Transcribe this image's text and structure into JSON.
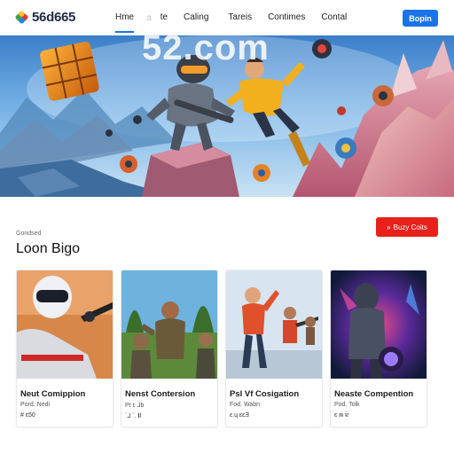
{
  "header": {
    "logo_text": "56d665",
    "nav": [
      {
        "label": "Hme",
        "active": true
      },
      {
        "label": "a"
      },
      {
        "label": "te"
      },
      {
        "label": "Caling"
      },
      {
        "label": "Tareis"
      },
      {
        "label": "Contimes"
      },
      {
        "label": "Contal"
      }
    ],
    "signin_label": "Bopin"
  },
  "hero": {
    "watermark": "52.com"
  },
  "section": {
    "label": "Gondsed",
    "title": "Loon Bigo",
    "cta_label": "Buzy Coits"
  },
  "cards": [
    {
      "title": "Neut Comippion",
      "sub": "Pord. Nedi",
      "price": "# ε50"
    },
    {
      "title": "Nenst Contersion",
      "sub": "Pt ε ⅃b",
      "price": "ˋ⅃ ˋ. 𝐈Ɩ"
    },
    {
      "title": "Psl Vf Cosigation",
      "sub": "Fod. Wabn",
      "price": "ε.ɥ ɛεƎ"
    },
    {
      "title": "Neaste Compention",
      "sub": "Pod. Tolk",
      "price": "ɛ ʍ  ɐ̈"
    }
  ],
  "colors": {
    "primary_blue": "#1a73e8",
    "cta_red": "#e8211c"
  }
}
